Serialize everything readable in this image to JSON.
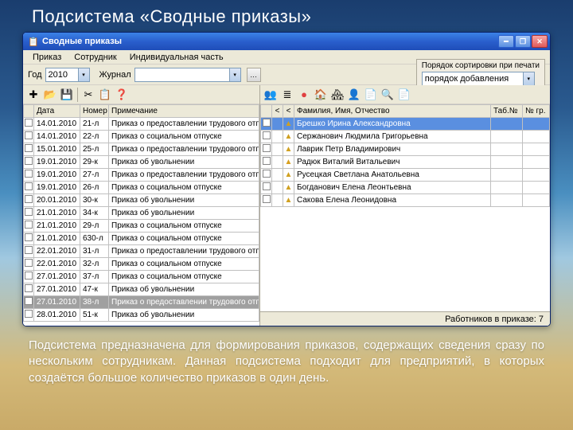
{
  "slide": {
    "title": "Подсистема «Сводные приказы»",
    "description": "Подсистема предназначена для формирования приказов, содержащих сведения сразу по нескольким сотрудникам. Данная подсистема подходит для предприятий, в которых создаётся большое количество приказов в один день."
  },
  "window": {
    "title": "Сводные приказы",
    "menu": {
      "order": "Приказ",
      "employee": "Сотрудник",
      "indiv": "Индивидуальная часть"
    },
    "filter": {
      "year_lbl": "Год",
      "year": "2010",
      "journal_lbl": "Журнал",
      "journal": "",
      "dots": "…"
    },
    "sort": {
      "caption": "Порядок сортировки при печати",
      "value": "порядок добавления"
    }
  },
  "left_grid": {
    "headers": {
      "date": "Дата",
      "num": "Номер",
      "note": "Примечание"
    },
    "rows": [
      {
        "date": "14.01.2010",
        "num": "21-л",
        "note": "Приказ о предоставлении трудового отпуска"
      },
      {
        "date": "14.01.2010",
        "num": "22-л",
        "note": "Приказ о социальном отпуске"
      },
      {
        "date": "15.01.2010",
        "num": "25-л",
        "note": "Приказ о предоставлении трудового отпуска"
      },
      {
        "date": "19.01.2010",
        "num": "29-к",
        "note": "Приказ об увольнении"
      },
      {
        "date": "19.01.2010",
        "num": "27-л",
        "note": "Приказ о предоставлении трудового отпуска"
      },
      {
        "date": "19.01.2010",
        "num": "26-л",
        "note": "Приказ о социальном отпуске"
      },
      {
        "date": "20.01.2010",
        "num": "30-к",
        "note": "Приказ об увольнении"
      },
      {
        "date": "21.01.2010",
        "num": "34-к",
        "note": "Приказ об увольнении"
      },
      {
        "date": "21.01.2010",
        "num": "29-л",
        "note": "Приказ о социальном отпуске"
      },
      {
        "date": "21.01.2010",
        "num": "630-л",
        "note": "Приказ о социальном отпуске"
      },
      {
        "date": "22.01.2010",
        "num": "31-л",
        "note": "Приказ о предоставлении трудового отпуска"
      },
      {
        "date": "22.01.2010",
        "num": "32-л",
        "note": "Приказ о социальном отпуске"
      },
      {
        "date": "27.01.2010",
        "num": "37-л",
        "note": "Приказ о социальном отпуске"
      },
      {
        "date": "27.01.2010",
        "num": "47-к",
        "note": "Приказ об увольнении"
      },
      {
        "date": "27.01.2010",
        "num": "38-л",
        "note": "Приказ о предоставлении трудового отпуска",
        "selected": true
      },
      {
        "date": "28.01.2010",
        "num": "51-к",
        "note": "Приказ об увольнении"
      }
    ]
  },
  "right_grid": {
    "headers": {
      "fio": "Фамилия, Имя, Отчество",
      "tab": "Таб.№",
      "grp": "№ гр."
    },
    "rows": [
      {
        "fio": "Брешко Ирина Александровна",
        "selected": true
      },
      {
        "fio": "Сержанович Людмила Григорьевна"
      },
      {
        "fio": "Лаврик Петр Владимирович"
      },
      {
        "fio": "Радюк Виталий Витальевич",
        "warn": true
      },
      {
        "fio": "Русецкая Светлана Анатольевна"
      },
      {
        "fio": "Богданович Елена Леонтьевна"
      },
      {
        "fio": "Сакова Елена Леонидовна"
      }
    ]
  },
  "status": {
    "count_lbl": "Работников в приказе: 7"
  },
  "icons": {
    "new": "✚",
    "open": "📂",
    "save": "💾",
    "cut": "✂",
    "copy": "📋",
    "help": "❓",
    "group": "👥",
    "list": "≣",
    "red": "●",
    "house": "🏠",
    "home2": "🏘",
    "peep": "👤",
    "search": "🔍",
    "doc": "📄",
    "warn": "⚠"
  }
}
